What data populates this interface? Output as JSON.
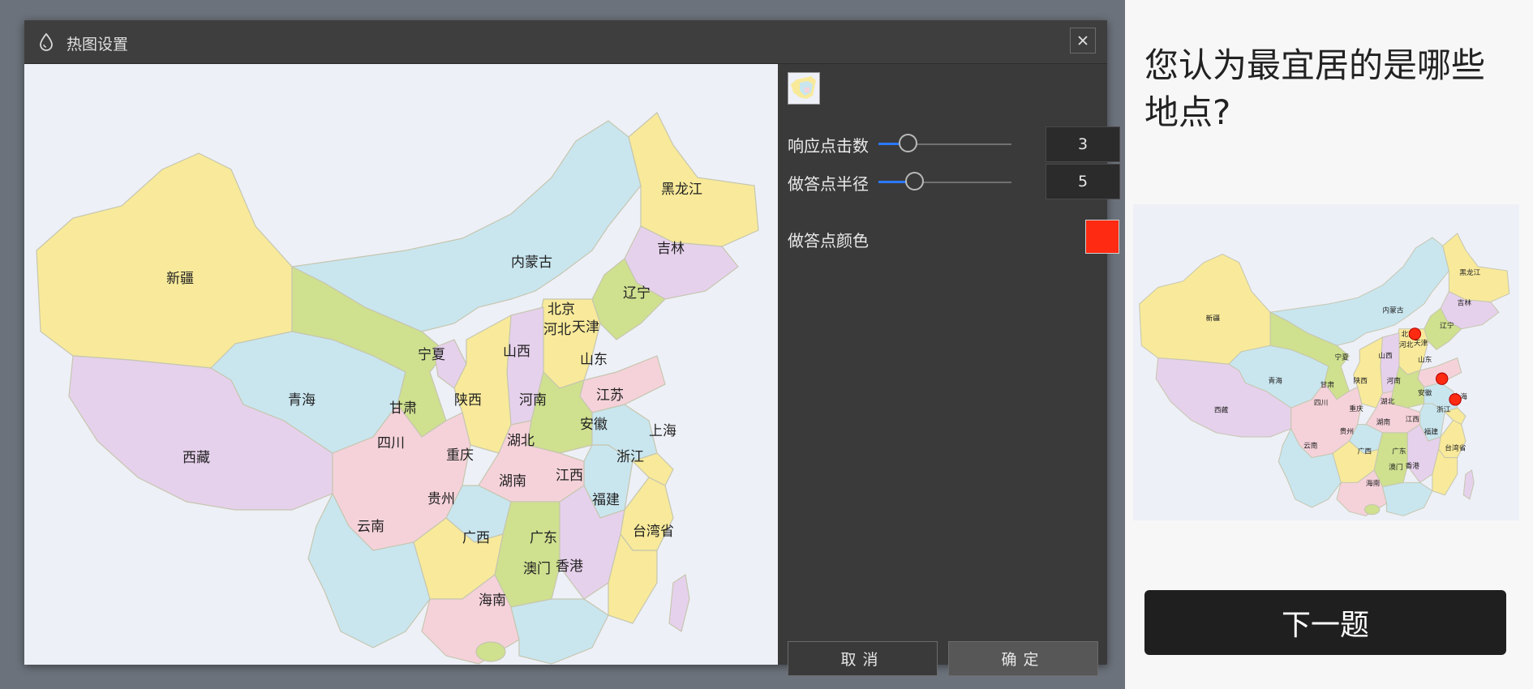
{
  "dialog": {
    "title": "热图设置",
    "settings": {
      "clicks": {
        "label": "响应点击数",
        "value": "3",
        "level": 0.22
      },
      "radius": {
        "label": "做答点半径",
        "value": "5",
        "level": 0.27
      },
      "color": {
        "label": "做答点颜色",
        "value": "#ff2a12"
      }
    },
    "cancel_label": "取消",
    "ok_label": "确定"
  },
  "map": {
    "provinces": {
      "xinjiang": "新疆",
      "xizang": "西藏",
      "qinghai": "青海",
      "gansu": "甘肃",
      "neimenggu": "内蒙古",
      "heilongjiang": "黑龙江",
      "jilin": "吉林",
      "liaoning": "辽宁",
      "beijing": "北京",
      "tianjin": "天津",
      "hebei": "河北",
      "shanxi": "山西",
      "shandong": "山东",
      "ningxia": "宁夏",
      "shaanxi": "陕西",
      "henan": "河南",
      "jiangsu": "江苏",
      "anhui": "安徽",
      "shanghai": "上海",
      "hubei": "湖北",
      "sichuan": "四川",
      "chongqing": "重庆",
      "zhejiang": "浙江",
      "hunan": "湖南",
      "jiangxi": "江西",
      "guizhou": "贵州",
      "yunnan": "云南",
      "guangxi": "广西",
      "guangdong": "广东",
      "fujian": "福建",
      "taiwan": "台湾省",
      "aomen": "澳门",
      "xianggang": "香港",
      "hainan": "海南"
    }
  },
  "preview": {
    "question": "您认为最宜居的是哪些地点?",
    "next_label": "下一题",
    "response_points": [
      "北京",
      "江苏",
      "上海"
    ]
  },
  "colors": {
    "accent": "#2a78ff",
    "response_dot": "#ff2a12",
    "yellow": "#f8ea9a",
    "blue": "#c9e6ef",
    "pink": "#f5d2da",
    "purple": "#e6d1ec",
    "green": "#cfe08f"
  }
}
